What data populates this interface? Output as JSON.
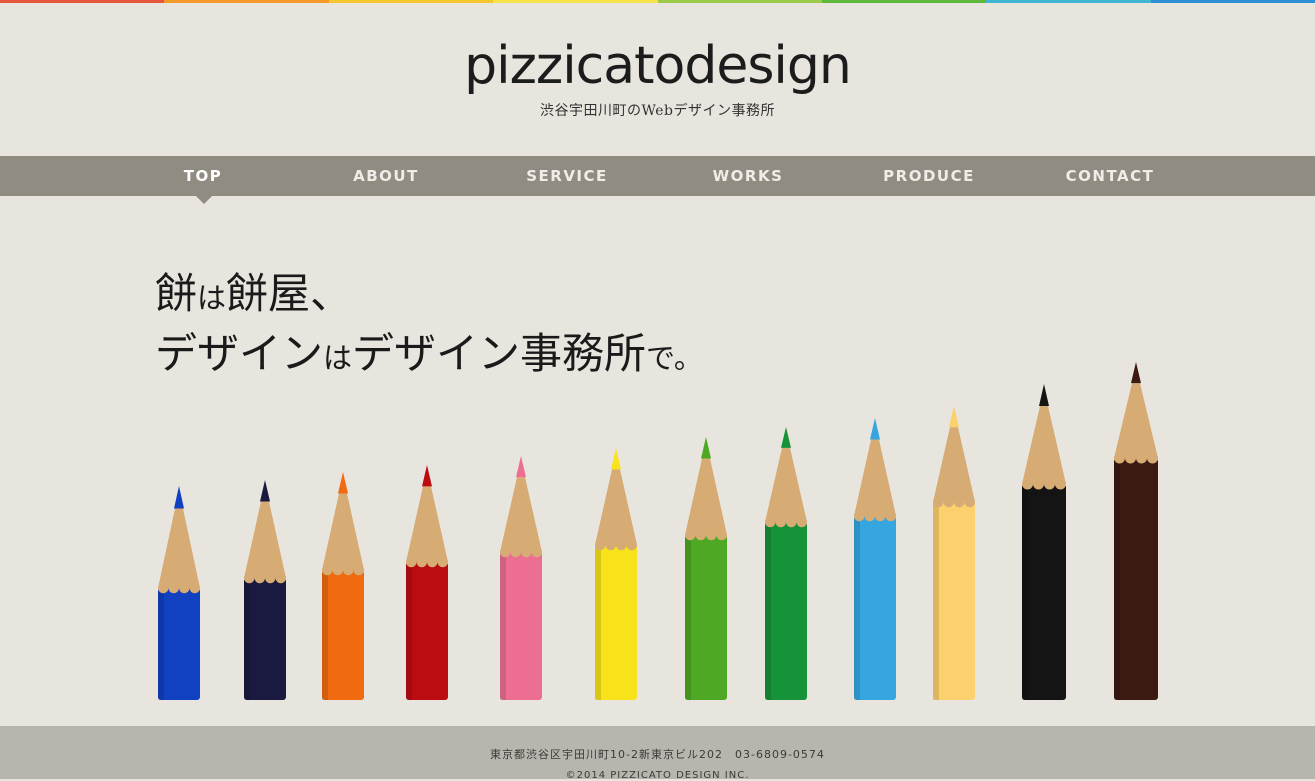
{
  "rainbow_colors": [
    "#e8553e",
    "#f39a2b",
    "#f6c62e",
    "#f6e24b",
    "#9ccb4b",
    "#5fb93b",
    "#3fb7d3",
    "#2d8fd6"
  ],
  "logo": {
    "wordmark": "pizzicatodesign",
    "tagline": "渋谷宇田川町のWebデザイン事務所"
  },
  "nav": {
    "items": [
      "TOP",
      "ABOUT",
      "SERVICE",
      "WORKS",
      "PRODUCE",
      "CONTACT"
    ],
    "active": "TOP"
  },
  "hero": {
    "line1_a": "餅",
    "line1_b": "は",
    "line1_c": "餅屋、",
    "line2_a": "デザイン",
    "line2_b": "は",
    "line2_c": "デザイン事務所",
    "line2_d": "で。"
  },
  "pencil_colors": [
    "#1140c0",
    "#1a1a40",
    "#f06a10",
    "#bb0c12",
    "#ec6f93",
    "#f8e31a",
    "#4ea824",
    "#169238",
    "#35a6df",
    "#fcd06c",
    "#141414",
    "#3a1a12"
  ],
  "footer": {
    "address": "東京都渋谷区宇田川町10-2新東京ビル202　03-6809-0574",
    "copyright": "©2014 PIZZICATO DESIGN INC."
  }
}
